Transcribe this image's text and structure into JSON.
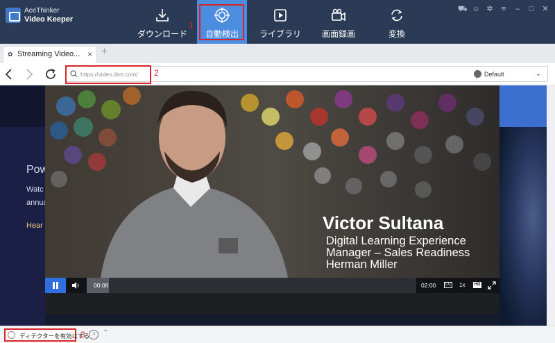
{
  "app": {
    "brand_line1": "AceThinker",
    "brand_line2": "Video Keeper"
  },
  "nav": {
    "items": [
      {
        "label": "ダウンロード",
        "icon": "download-icon"
      },
      {
        "label": "自動検出",
        "icon": "target-icon",
        "active": true
      },
      {
        "label": "ライブラリ",
        "icon": "play-library-icon"
      },
      {
        "label": "画面録画",
        "icon": "camera-icon"
      },
      {
        "label": "変換",
        "icon": "convert-icon"
      }
    ],
    "window_icons": [
      "cart-icon",
      "user-icon",
      "apps-icon",
      "menu-icon",
      "minimize-icon",
      "maximize-icon",
      "close-icon"
    ]
  },
  "annotations": {
    "n1": "1",
    "n2": "2",
    "n3": "3"
  },
  "tab": {
    "title": "Streaming Video...",
    "close": "×",
    "new_tab": "+"
  },
  "address": {
    "url": "https://video.ibm.com/",
    "engine": "Default"
  },
  "page": {
    "heading": "Pow",
    "line1": "Watc",
    "line2": "annua",
    "link": "Hear y"
  },
  "video": {
    "name": "Victor Sultana",
    "title_line1": "Digital Learning Experience",
    "title_line2": "Manager – Sales Readiness",
    "title_line3": "Herman Miller",
    "current_time": "00:08",
    "duration": "02:00",
    "progress_fraction": 0.067,
    "speed": "1x",
    "cc": "CC",
    "hd": "HD"
  },
  "status": {
    "detector_label": "ディテクターを有効にする"
  },
  "colors": {
    "topbar": "#2b3a55",
    "active_nav": "#4d8de0",
    "highlight": "#d6262b",
    "player_accent": "#2f6fe0"
  }
}
